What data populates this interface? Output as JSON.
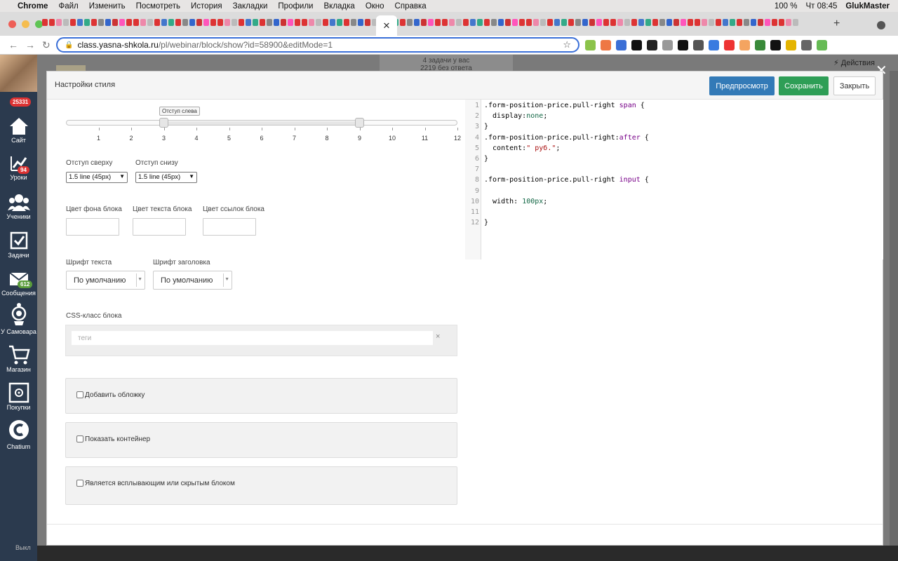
{
  "menubar": {
    "apple": "",
    "app": "Chrome",
    "items": [
      "Файл",
      "Изменить",
      "Посмотреть",
      "История",
      "Закладки",
      "Профили",
      "Вкладка",
      "Окно",
      "Справка"
    ],
    "battery": "100 %",
    "clock": "Чт 08:45",
    "user": "GlukMaster"
  },
  "tabs": {
    "active_close": "✕",
    "new_tab": "+"
  },
  "address": {
    "host": "class.yasna-shkola.ru",
    "path": "/pl/webinar/block/show?id=58900&editMode=1"
  },
  "behind": {
    "tasks_text": "4 задачи у вас",
    "tasks_sub": "2219 без ответа",
    "actions": "Действия"
  },
  "sidebar": {
    "total_badge": "25331",
    "items": [
      {
        "label": "Сайт",
        "icon": "home-icon"
      },
      {
        "label": "Уроки",
        "icon": "chart-icon",
        "badge": "94"
      },
      {
        "label": "Ученики",
        "icon": "users-icon"
      },
      {
        "label": "Задачи",
        "icon": "checkbox-icon"
      },
      {
        "label": "Сообщения",
        "icon": "envelope-icon",
        "badge": "612"
      },
      {
        "label": "У Самовара",
        "icon": "samovar-icon"
      },
      {
        "label": "Магазин",
        "icon": "cart-icon"
      },
      {
        "label": "Покупки",
        "icon": "safe-icon"
      },
      {
        "label": "Chatium",
        "icon": "chatium-icon"
      }
    ],
    "bottom_text": "Выкл"
  },
  "modal": {
    "title": "Настройки стиля",
    "buttons": {
      "preview": "Предпросмотр",
      "save": "Сохранить",
      "close": "Закрыть"
    },
    "slider": {
      "tooltip": "Отступ слева",
      "scale": [
        "1",
        "2",
        "3",
        "4",
        "5",
        "6",
        "7",
        "8",
        "9",
        "10",
        "11",
        "12"
      ],
      "left_value": 3,
      "right_value": 9
    },
    "padding_top": {
      "label": "Отступ сверху",
      "value": "1.5 line (45px)"
    },
    "padding_bottom": {
      "label": "Отступ снизу",
      "value": "1.5 line (45px)"
    },
    "colors": {
      "bg_label": "Цвет фона блока",
      "text_label": "Цвет текста блока",
      "link_label": "Цвет ссылок блока"
    },
    "font_text": {
      "label": "Шрифт текста",
      "value": "По умолчанию"
    },
    "font_heading": {
      "label": "Шрифт заголовка",
      "value": "По умолчанию"
    },
    "css_class": {
      "label": "CSS-класс блока",
      "placeholder": "теги",
      "clear": "×"
    },
    "checkboxes": [
      {
        "label": "Добавить обложку"
      },
      {
        "label": "Показать контейнер"
      },
      {
        "label": "Является всплывающим или скрытым блоком"
      }
    ],
    "code": [
      {
        "n": "1",
        "sel": ".form-position-price.pull-right ",
        "kw": "span",
        "rest": " {"
      },
      {
        "n": "2",
        "prop": "  display:",
        "val": "none",
        "end": ";"
      },
      {
        "n": "3",
        "plain": "}"
      },
      {
        "n": "4",
        "sel": ".form-position-price.pull-right:",
        "kw": "after",
        "rest": " {"
      },
      {
        "n": "5",
        "prop": "  content:",
        "str": "\" руб.\"",
        "end": ";"
      },
      {
        "n": "6",
        "plain": "}"
      },
      {
        "n": "7",
        "plain": ""
      },
      {
        "n": "8",
        "sel": ".form-position-price.pull-right ",
        "kw": "input",
        "rest": " {"
      },
      {
        "n": "9",
        "plain": ""
      },
      {
        "n": "10",
        "prop": "  width: ",
        "num": "100px",
        "end": ";"
      },
      {
        "n": "11",
        "plain": ""
      },
      {
        "n": "12",
        "plain": "}"
      }
    ]
  },
  "colors": {
    "primary": "#337ab7",
    "success": "#2e9e56",
    "sidebar": "#2b3a4e",
    "badge": "#dd3333"
  }
}
